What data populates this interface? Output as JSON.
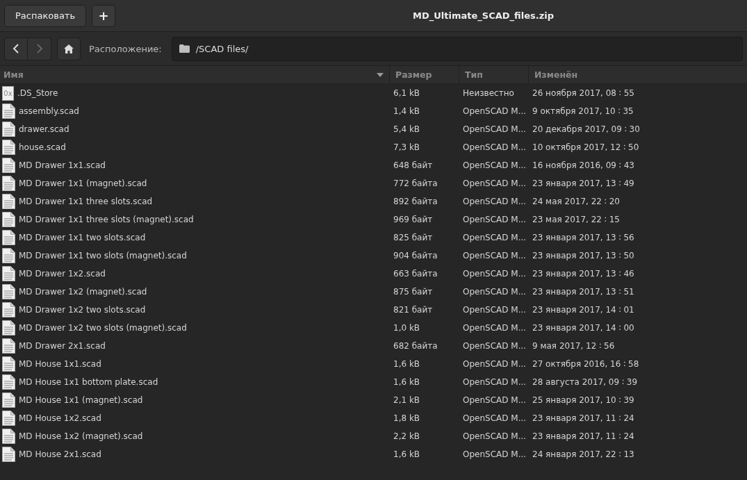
{
  "header_bar": {
    "extract_button": "Распаковать",
    "add_button": "+",
    "title": "MD_Ultimate_SCAD_files.zip"
  },
  "toolbar": {
    "back_disabled": false,
    "forward_disabled": true,
    "location_label": "Расположение:",
    "location": "/SCAD files/"
  },
  "table": {
    "columns": [
      {
        "label": "Имя",
        "sorted": true
      },
      {
        "label": "Размер",
        "sorted": false
      },
      {
        "label": "Тип",
        "sorted": false
      },
      {
        "label": "Изменён",
        "sorted": false
      }
    ],
    "rows": [
      {
        "kind": "binary",
        "icon_text": "0x",
        "name": ".DS_Store",
        "size": "6,1 kB",
        "type": "Неизвестно",
        "modified": "26 ноября 2017, 08 ∶ 55"
      },
      {
        "kind": "text",
        "name": "assembly.scad",
        "size": "1,4 kB",
        "type": "OpenSCAD M...",
        "modified": "9 октября 2017, 10 ∶ 35"
      },
      {
        "kind": "text",
        "name": "drawer.scad",
        "size": "5,4 kB",
        "type": "OpenSCAD M...",
        "modified": "20 декабря 2017, 09 ∶ 30"
      },
      {
        "kind": "text",
        "name": "house.scad",
        "size": "7,3 kB",
        "type": "OpenSCAD M...",
        "modified": "10 октября 2017, 12 ∶ 50"
      },
      {
        "kind": "text",
        "name": "MD Drawer 1x1.scad",
        "size": "648 байт",
        "type": "OpenSCAD M...",
        "modified": "16 ноября 2016, 09 ∶ 43"
      },
      {
        "kind": "text",
        "name": "MD Drawer 1x1 (magnet).scad",
        "size": "772 байта",
        "type": "OpenSCAD M...",
        "modified": "23 января 2017, 13 ∶ 49"
      },
      {
        "kind": "text",
        "name": "MD Drawer 1x1 three slots.scad",
        "size": "892 байта",
        "type": "OpenSCAD M...",
        "modified": "24 мая 2017, 22 ∶ 20"
      },
      {
        "kind": "text",
        "name": "MD Drawer 1x1 three slots (magnet).scad",
        "size": "969 байт",
        "type": "OpenSCAD M...",
        "modified": "23 мая 2017, 22 ∶ 15"
      },
      {
        "kind": "text",
        "name": "MD Drawer 1x1 two slots.scad",
        "size": "825 байт",
        "type": "OpenSCAD M...",
        "modified": "23 января 2017, 13 ∶ 56"
      },
      {
        "kind": "text",
        "name": "MD Drawer 1x1 two slots (magnet).scad",
        "size": "904 байта",
        "type": "OpenSCAD M...",
        "modified": "23 января 2017, 13 ∶ 50"
      },
      {
        "kind": "text",
        "name": "MD Drawer 1x2.scad",
        "size": "663 байта",
        "type": "OpenSCAD M...",
        "modified": "23 января 2017, 13 ∶ 46"
      },
      {
        "kind": "text",
        "name": "MD Drawer 1x2 (magnet).scad",
        "size": "875 байт",
        "type": "OpenSCAD M...",
        "modified": "23 января 2017, 13 ∶ 51"
      },
      {
        "kind": "text",
        "name": "MD Drawer 1x2 two slots.scad",
        "size": "821 байт",
        "type": "OpenSCAD M...",
        "modified": "23 января 2017, 14 ∶ 01"
      },
      {
        "kind": "text",
        "name": "MD Drawer 1x2 two slots (magnet).scad",
        "size": "1,0 kB",
        "type": "OpenSCAD M...",
        "modified": "23 января 2017, 14 ∶ 00"
      },
      {
        "kind": "text",
        "name": "MD Drawer 2x1.scad",
        "size": "682 байта",
        "type": "OpenSCAD M...",
        "modified": "9 мая 2017, 12 ∶ 56"
      },
      {
        "kind": "text",
        "name": "MD House 1x1.scad",
        "size": "1,6 kB",
        "type": "OpenSCAD M...",
        "modified": "27 октября 2016, 16 ∶ 58"
      },
      {
        "kind": "text",
        "name": "MD House 1x1 bottom plate.scad",
        "size": "1,6 kB",
        "type": "OpenSCAD M...",
        "modified": "28 августа 2017, 09 ∶ 39"
      },
      {
        "kind": "text",
        "name": "MD House 1x1 (magnet).scad",
        "size": "2,1 kB",
        "type": "OpenSCAD M...",
        "modified": "25 января 2017, 10 ∶ 39"
      },
      {
        "kind": "text",
        "name": "MD House 1x2.scad",
        "size": "1,8 kB",
        "type": "OpenSCAD M...",
        "modified": "23 января 2017, 11 ∶ 24"
      },
      {
        "kind": "text",
        "name": "MD House 1x2 (magnet).scad",
        "size": "2,2 kB",
        "type": "OpenSCAD M...",
        "modified": "23 января 2017, 11 ∶ 24"
      },
      {
        "kind": "text",
        "name": "MD House 2x1.scad",
        "size": "1,6 kB",
        "type": "OpenSCAD M...",
        "modified": "24 января 2017, 22 ∶ 13"
      }
    ]
  }
}
